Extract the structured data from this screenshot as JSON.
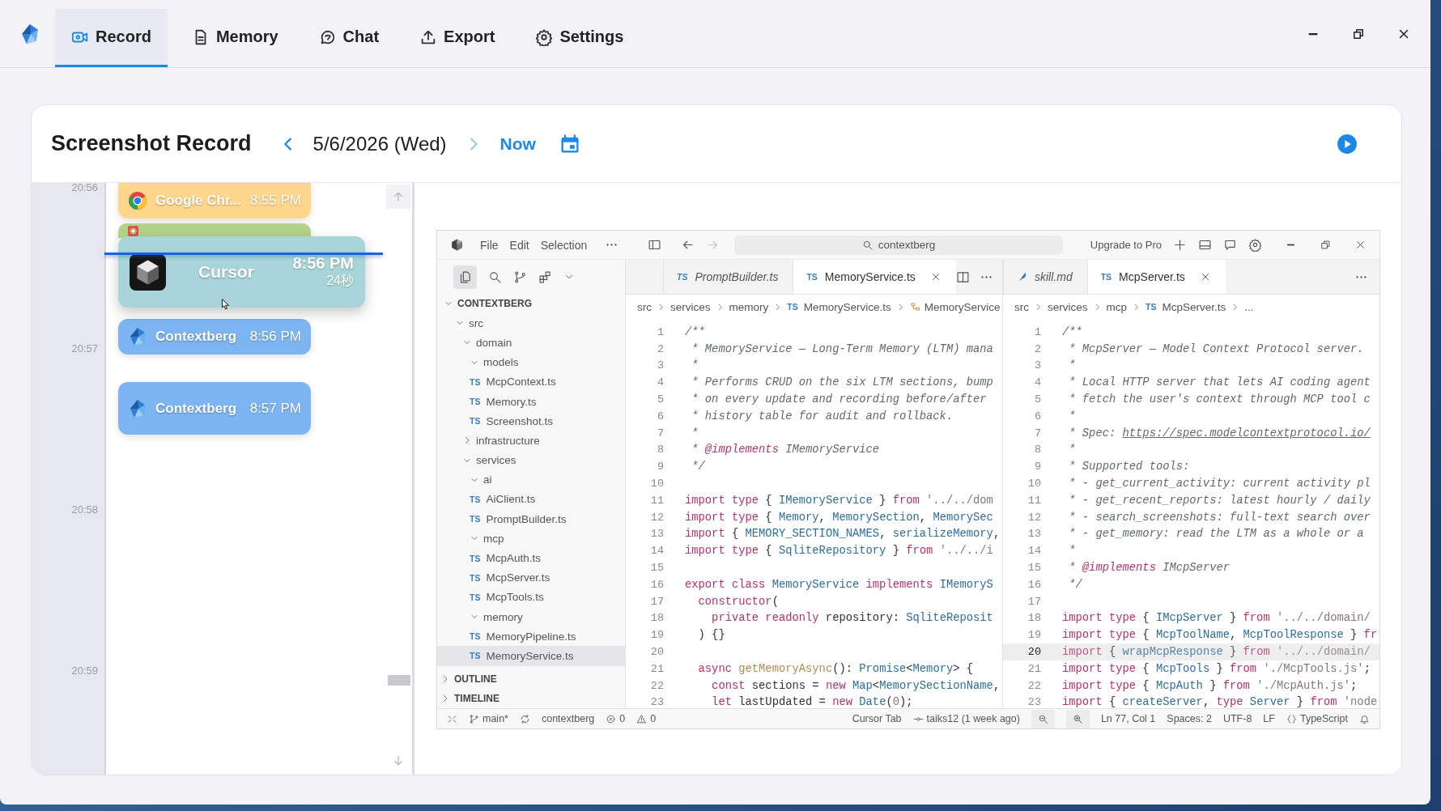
{
  "nav": {
    "tabs": [
      {
        "label": "Record",
        "selected": true
      },
      {
        "label": "Memory",
        "selected": false
      },
      {
        "label": "Chat",
        "selected": false
      },
      {
        "label": "Export",
        "selected": false
      },
      {
        "label": "Settings",
        "selected": false
      }
    ]
  },
  "record": {
    "title": "Screenshot Record",
    "date": "5/6/2026 (Wed)",
    "now": "Now",
    "timeline": {
      "times": [
        "20:56",
        "20:57",
        "20:58",
        "20:59"
      ],
      "entries": [
        {
          "kind": "card",
          "app": "Google Chr...",
          "time": "8:55 PM",
          "color": "#ffd78c"
        },
        {
          "kind": "strip",
          "color": "#b3d38b"
        },
        {
          "kind": "expanded",
          "app": "Cursor",
          "time": "8:56 PM",
          "duration": "24秒",
          "color": "#a8d5d9"
        },
        {
          "kind": "card",
          "app": "Contextberg",
          "time": "8:56 PM",
          "color": "#7db5f2"
        },
        {
          "kind": "card",
          "app": "Contextberg",
          "time": "8:57 PM",
          "color": "#7db5f2"
        }
      ]
    }
  },
  "vscode": {
    "menu": [
      "File",
      "Edit",
      "Selection"
    ],
    "search": "contextberg",
    "upgrade": "Upgrade to Pro",
    "explorer": {
      "title": "CONTEXTBERG",
      "expanded": true,
      "tree": [
        {
          "label": "src",
          "kind": "folder",
          "expanded": true,
          "selected": false,
          "children": [
            {
              "label": "domain",
              "kind": "folder",
              "expanded": true,
              "selected": false,
              "children": [
                {
                  "label": "models",
                  "kind": "folder",
                  "expanded": true,
                  "selected": false,
                  "children": [
                    {
                      "label": "McpContext.ts",
                      "kind": "file",
                      "badge": "TS",
                      "selected": false
                    },
                    {
                      "label": "Memory.ts",
                      "kind": "file",
                      "badge": "TS",
                      "selected": false
                    },
                    {
                      "label": "Screenshot.ts",
                      "kind": "file",
                      "badge": "TS",
                      "selected": false
                    }
                  ]
                }
              ]
            },
            {
              "label": "infrastructure",
              "kind": "folder",
              "expanded": false,
              "selected": false
            },
            {
              "label": "services",
              "kind": "folder",
              "expanded": true,
              "selected": false,
              "children": [
                {
                  "label": "ai",
                  "kind": "folder",
                  "expanded": true,
                  "selected": false,
                  "children": [
                    {
                      "label": "AiClient.ts",
                      "kind": "file",
                      "badge": "TS",
                      "selected": false
                    },
                    {
                      "label": "PromptBuilder.ts",
                      "kind": "file",
                      "badge": "TS",
                      "selected": false
                    }
                  ]
                },
                {
                  "label": "mcp",
                  "kind": "folder",
                  "expanded": true,
                  "selected": false,
                  "children": [
                    {
                      "label": "McpAuth.ts",
                      "kind": "file",
                      "badge": "TS",
                      "selected": false
                    },
                    {
                      "label": "McpServer.ts",
                      "kind": "file",
                      "badge": "TS",
                      "selected": false
                    },
                    {
                      "label": "McpTools.ts",
                      "kind": "file",
                      "badge": "TS",
                      "selected": false
                    }
                  ]
                },
                {
                  "label": "memory",
                  "kind": "folder",
                  "expanded": true,
                  "selected": false,
                  "children": [
                    {
                      "label": "MemoryPipeline.ts",
                      "kind": "file",
                      "badge": "TS",
                      "selected": false
                    },
                    {
                      "label": "MemoryService.ts",
                      "kind": "file",
                      "badge": "TS",
                      "selected": true
                    }
                  ]
                }
              ]
            }
          ]
        }
      ],
      "sections": [
        {
          "label": "OUTLINE",
          "expanded": false
        },
        {
          "label": "TIMELINE",
          "expanded": false
        }
      ]
    },
    "groups": [
      {
        "tabs": [
          {
            "label": "PromptBuilder.ts",
            "kind": "typescript",
            "badge": "TS",
            "preview": true,
            "selected": false
          },
          {
            "label": "MemoryService.ts",
            "kind": "typescript",
            "badge": "TS",
            "preview": false,
            "selected": true
          }
        ],
        "breadcrumbs": [
          {
            "text": "src",
            "kind": "folder"
          },
          {
            "text": "services",
            "kind": "folder"
          },
          {
            "text": "memory",
            "kind": "folder"
          },
          {
            "text": "MemoryService.ts",
            "kind": "file",
            "badge": "TS"
          },
          {
            "text": "MemoryService",
            "kind": "class"
          }
        ],
        "lines": [
          {
            "number": "1",
            "active": false,
            "parts": [
              {
                "kind": "comment",
                "text": "/**"
              }
            ]
          },
          {
            "number": "2",
            "active": false,
            "parts": [
              {
                "kind": "comment",
                "text": " * MemoryService — Long-Term Memory (LTM) mana"
              }
            ]
          },
          {
            "number": "3",
            "active": false,
            "parts": [
              {
                "kind": "comment",
                "text": " *"
              }
            ]
          },
          {
            "number": "4",
            "active": false,
            "parts": [
              {
                "kind": "comment",
                "text": " * Performs CRUD on the six LTM sections, bump"
              }
            ]
          },
          {
            "number": "5",
            "active": false,
            "parts": [
              {
                "kind": "comment",
                "text": " * on every update and recording before/after"
              }
            ]
          },
          {
            "number": "6",
            "active": false,
            "parts": [
              {
                "kind": "comment",
                "text": " * history table for audit and rollback."
              }
            ]
          },
          {
            "number": "7",
            "active": false,
            "parts": [
              {
                "kind": "comment",
                "text": " *"
              }
            ]
          },
          {
            "number": "8",
            "active": false,
            "parts": [
              {
                "kind": "comment",
                "text": " * "
              },
              {
                "kind": "tag",
                "text": "@implements"
              },
              {
                "kind": "comment",
                "text": " IMemoryService"
              }
            ]
          },
          {
            "number": "9",
            "active": false,
            "parts": [
              {
                "kind": "comment",
                "text": " */"
              }
            ]
          },
          {
            "number": "10",
            "active": false
          },
          {
            "number": "11",
            "active": false,
            "parts": [
              {
                "kind": "keyword",
                "text": "import type"
              },
              {
                "kind": "plain",
                "text": " { "
              },
              {
                "kind": "type",
                "text": "IMemoryService"
              },
              {
                "kind": "plain",
                "text": " } "
              },
              {
                "kind": "keyword",
                "text": "from"
              },
              {
                "kind": "string",
                "text": " '../../dom"
              }
            ]
          },
          {
            "number": "12",
            "active": false,
            "parts": [
              {
                "kind": "keyword",
                "text": "import type"
              },
              {
                "kind": "plain",
                "text": " { "
              },
              {
                "kind": "type",
                "text": "Memory"
              },
              {
                "kind": "plain",
                "text": ", "
              },
              {
                "kind": "type",
                "text": "MemorySection"
              },
              {
                "kind": "plain",
                "text": ", "
              },
              {
                "kind": "type",
                "text": "MemorySec"
              }
            ]
          },
          {
            "number": "13",
            "active": false,
            "parts": [
              {
                "kind": "keyword",
                "text": "import"
              },
              {
                "kind": "plain",
                "text": " { "
              },
              {
                "kind": "type",
                "text": "MEMORY_SECTION_NAMES"
              },
              {
                "kind": "plain",
                "text": ", "
              },
              {
                "kind": "type",
                "text": "serializeMemory"
              },
              {
                "kind": "plain",
                "text": ","
              }
            ]
          },
          {
            "number": "14",
            "active": false,
            "parts": [
              {
                "kind": "keyword",
                "text": "import type"
              },
              {
                "kind": "plain",
                "text": " { "
              },
              {
                "kind": "type",
                "text": "SqliteRepository"
              },
              {
                "kind": "plain",
                "text": " } "
              },
              {
                "kind": "keyword",
                "text": "from"
              },
              {
                "kind": "string",
                "text": " '../../i"
              }
            ]
          },
          {
            "number": "15",
            "active": false
          },
          {
            "number": "16",
            "active": false,
            "parts": [
              {
                "kind": "keyword",
                "text": "export class"
              },
              {
                "kind": "type",
                "text": " MemoryService"
              },
              {
                "kind": "keyword",
                "text": " implements"
              },
              {
                "kind": "type",
                "text": " IMemoryS"
              }
            ]
          },
          {
            "number": "17",
            "active": false,
            "parts": [
              {
                "kind": "keyword",
                "text": "  constructor"
              },
              {
                "kind": "plain",
                "text": "("
              }
            ]
          },
          {
            "number": "18",
            "active": false,
            "parts": [
              {
                "kind": "keyword",
                "text": "    private readonly"
              },
              {
                "kind": "plain",
                "text": " repository: "
              },
              {
                "kind": "type",
                "text": "SqliteReposit"
              }
            ]
          },
          {
            "number": "19",
            "active": false,
            "parts": [
              {
                "kind": "plain",
                "text": "  ) {}"
              }
            ]
          },
          {
            "number": "20",
            "active": false
          },
          {
            "number": "21",
            "active": false,
            "parts": [
              {
                "kind": "keyword",
                "text": "  async"
              },
              {
                "kind": "function",
                "text": " getMemoryAsync"
              },
              {
                "kind": "plain",
                "text": "(): "
              },
              {
                "kind": "type",
                "text": "Promise"
              },
              {
                "kind": "plain",
                "text": "<"
              },
              {
                "kind": "type",
                "text": "Memory"
              },
              {
                "kind": "plain",
                "text": "> {"
              }
            ]
          },
          {
            "number": "22",
            "active": false,
            "parts": [
              {
                "kind": "keyword",
                "text": "    const"
              },
              {
                "kind": "plain",
                "text": " sections = "
              },
              {
                "kind": "keyword",
                "text": "new"
              },
              {
                "kind": "type",
                "text": " Map"
              },
              {
                "kind": "plain",
                "text": "<"
              },
              {
                "kind": "type",
                "text": "MemorySectionName"
              },
              {
                "kind": "plain",
                "text": ","
              }
            ]
          },
          {
            "number": "23",
            "active": false,
            "parts": [
              {
                "kind": "keyword",
                "text": "    let"
              },
              {
                "kind": "plain",
                "text": " lastUpdated = "
              },
              {
                "kind": "keyword",
                "text": "new"
              },
              {
                "kind": "type",
                "text": " Date"
              },
              {
                "kind": "plain",
                "text": "("
              },
              {
                "kind": "string",
                "text": "0"
              },
              {
                "kind": "plain",
                "text": ");"
              }
            ]
          }
        ]
      },
      {
        "tabs": [
          {
            "label": "skill.md",
            "kind": "markdown",
            "preview": true,
            "selected": false
          },
          {
            "label": "McpServer.ts",
            "kind": "typescript",
            "badge": "TS",
            "preview": false,
            "selected": true
          }
        ],
        "breadcrumbs": [
          {
            "text": "src",
            "kind": "folder"
          },
          {
            "text": "services",
            "kind": "folder"
          },
          {
            "text": "mcp",
            "kind": "folder"
          },
          {
            "text": "McpServer.ts",
            "kind": "file",
            "badge": "TS"
          },
          {
            "text": "...",
            "kind": "more"
          }
        ],
        "lines": [
          {
            "number": "1",
            "active": false,
            "parts": [
              {
                "kind": "comment",
                "text": "/**"
              }
            ]
          },
          {
            "number": "2",
            "active": false,
            "parts": [
              {
                "kind": "comment",
                "text": " * McpServer — Model Context Protocol server."
              }
            ]
          },
          {
            "number": "3",
            "active": false,
            "parts": [
              {
                "kind": "comment",
                "text": " *"
              }
            ]
          },
          {
            "number": "4",
            "active": false,
            "parts": [
              {
                "kind": "comment",
                "text": " * Local HTTP server that lets AI coding agent"
              }
            ]
          },
          {
            "number": "5",
            "active": false,
            "parts": [
              {
                "kind": "comment",
                "text": " * fetch the user's context through MCP tool c"
              }
            ]
          },
          {
            "number": "6",
            "active": false,
            "parts": [
              {
                "kind": "comment",
                "text": " *"
              }
            ]
          },
          {
            "number": "7",
            "active": false,
            "parts": [
              {
                "kind": "comment",
                "text": " * Spec: "
              },
              {
                "kind": "link",
                "text": "https://spec.modelcontextprotocol.io/"
              }
            ]
          },
          {
            "number": "8",
            "active": false,
            "parts": [
              {
                "kind": "comment",
                "text": " *"
              }
            ]
          },
          {
            "number": "9",
            "active": false,
            "parts": [
              {
                "kind": "comment",
                "text": " * Supported tools:"
              }
            ]
          },
          {
            "number": "10",
            "active": false,
            "parts": [
              {
                "kind": "comment",
                "text": " * - get_current_activity: current activity pl"
              }
            ]
          },
          {
            "number": "11",
            "active": false,
            "parts": [
              {
                "kind": "comment",
                "text": " * - get_recent_reports: latest hourly / daily"
              }
            ]
          },
          {
            "number": "12",
            "active": false,
            "parts": [
              {
                "kind": "comment",
                "text": " * - search_screenshots: full-text search over"
              }
            ]
          },
          {
            "number": "13",
            "active": false,
            "parts": [
              {
                "kind": "comment",
                "text": " * - get_memory: read the LTM as a whole or a"
              }
            ]
          },
          {
            "number": "14",
            "active": false,
            "parts": [
              {
                "kind": "comment",
                "text": " *"
              }
            ]
          },
          {
            "number": "15",
            "active": false,
            "parts": [
              {
                "kind": "comment",
                "text": " * "
              },
              {
                "kind": "tag",
                "text": "@implements"
              },
              {
                "kind": "comment",
                "text": " IMcpServer"
              }
            ]
          },
          {
            "number": "16",
            "active": false,
            "parts": [
              {
                "kind": "comment",
                "text": " */"
              }
            ]
          },
          {
            "number": "17",
            "active": false
          },
          {
            "number": "18",
            "active": false,
            "parts": [
              {
                "kind": "keyword",
                "text": "import type"
              },
              {
                "kind": "plain",
                "text": " { "
              },
              {
                "kind": "type",
                "text": "IMcpServer"
              },
              {
                "kind": "plain",
                "text": " } "
              },
              {
                "kind": "keyword",
                "text": "from"
              },
              {
                "kind": "string",
                "text": " '../../domain/"
              }
            ]
          },
          {
            "number": "19",
            "active": false,
            "parts": [
              {
                "kind": "keyword",
                "text": "import type"
              },
              {
                "kind": "plain",
                "text": " { "
              },
              {
                "kind": "type",
                "text": "McpToolName"
              },
              {
                "kind": "plain",
                "text": ", "
              },
              {
                "kind": "type",
                "text": "McpToolResponse"
              },
              {
                "kind": "plain",
                "text": " } "
              },
              {
                "kind": "keyword",
                "text": "fr"
              }
            ]
          },
          {
            "number": "20",
            "active": true,
            "parts": [
              {
                "kind": "keyword",
                "text": "import"
              },
              {
                "kind": "plain",
                "text": " { "
              },
              {
                "kind": "type",
                "text": "wrapMcpResponse"
              },
              {
                "kind": "plain",
                "text": " } "
              },
              {
                "kind": "keyword",
                "text": "from"
              },
              {
                "kind": "string",
                "text": " '../../domain/"
              }
            ]
          },
          {
            "number": "21",
            "active": false,
            "parts": [
              {
                "kind": "keyword",
                "text": "import type"
              },
              {
                "kind": "plain",
                "text": " { "
              },
              {
                "kind": "type",
                "text": "McpTools"
              },
              {
                "kind": "plain",
                "text": " } "
              },
              {
                "kind": "keyword",
                "text": "from"
              },
              {
                "kind": "string",
                "text": " './McpTools.js'"
              },
              {
                "kind": "plain",
                "text": ";"
              }
            ]
          },
          {
            "number": "22",
            "active": false,
            "parts": [
              {
                "kind": "keyword",
                "text": "import type"
              },
              {
                "kind": "plain",
                "text": " { "
              },
              {
                "kind": "type",
                "text": "McpAuth"
              },
              {
                "kind": "plain",
                "text": " } "
              },
              {
                "kind": "keyword",
                "text": "from"
              },
              {
                "kind": "string",
                "text": " './McpAuth.js'"
              },
              {
                "kind": "plain",
                "text": ";"
              }
            ]
          },
          {
            "number": "23",
            "active": false,
            "parts": [
              {
                "kind": "keyword",
                "text": "import"
              },
              {
                "kind": "plain",
                "text": " { "
              },
              {
                "kind": "type",
                "text": "createServer"
              },
              {
                "kind": "plain",
                "text": ", "
              },
              {
                "kind": "keyword",
                "text": "type"
              },
              {
                "kind": "type",
                "text": " Server"
              },
              {
                "kind": "plain",
                "text": " } "
              },
              {
                "kind": "keyword",
                "text": "from"
              },
              {
                "kind": "string",
                "text": " 'node"
              }
            ]
          }
        ]
      }
    ],
    "status": {
      "left": [
        {
          "kind": "remote"
        },
        {
          "kind": "branch",
          "text": "main*"
        },
        {
          "kind": "sync"
        },
        {
          "kind": "plain",
          "text": "contextberg"
        },
        {
          "kind": "error",
          "text": "0"
        },
        {
          "kind": "warning",
          "text": "0"
        }
      ],
      "right": [
        {
          "kind": "plain",
          "text": "Cursor Tab"
        },
        {
          "kind": "commit",
          "text": "taiks12 (1 week ago)"
        },
        {
          "kind": "zoom-out"
        },
        {
          "kind": "zoom-in"
        },
        {
          "kind": "plain",
          "text": "Ln 77, Col 1"
        },
        {
          "kind": "plain",
          "text": "Spaces: 2"
        },
        {
          "kind": "plain",
          "text": "UTF-8"
        },
        {
          "kind": "plain",
          "text": "LF"
        },
        {
          "kind": "braces",
          "text": "TypeScript"
        },
        {
          "kind": "bell"
        }
      ]
    }
  }
}
